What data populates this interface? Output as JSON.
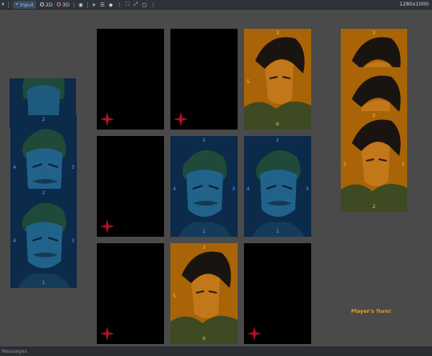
{
  "toolbar": {
    "input_label": "Input",
    "mode_2d": "2D",
    "mode_3d": "3D",
    "resolution": "1280x1000"
  },
  "statusbar": {
    "text": "Messages"
  },
  "game": {
    "turn_text": "Player's Turn!",
    "colors": {
      "blue_card": "#0c2a49",
      "orange_card": "#a86407",
      "back": "#000000",
      "star": "#b0102a",
      "turn_text": "#f0a020"
    }
  },
  "hand_left": [
    {
      "top": "",
      "left": "",
      "right": "",
      "bottom": ""
    },
    {
      "top": "2",
      "left": "4",
      "right": "3",
      "bottom": ""
    },
    {
      "top": "2",
      "left": "4",
      "right": "3",
      "bottom": "1"
    }
  ],
  "board": [
    {
      "type": "back"
    },
    {
      "type": "back"
    },
    {
      "type": "orange",
      "top": "3",
      "left": "5",
      "right": "",
      "bottom": "6"
    },
    {
      "type": "back"
    },
    {
      "type": "blue",
      "top": "2",
      "left": "4",
      "right": "3",
      "bottom": "1"
    },
    {
      "type": "blue",
      "top": "2",
      "left": "4",
      "right": "3",
      "bottom": "1"
    },
    {
      "type": "back"
    },
    {
      "type": "orange",
      "top": "3",
      "left": "5",
      "right": "",
      "bottom": "6"
    },
    {
      "type": "back"
    }
  ],
  "hand_right": [
    {
      "top": "3",
      "left": "",
      "right": "",
      "bottom": "1"
    },
    {
      "top": "",
      "left": "",
      "right": "",
      "bottom": ""
    },
    {
      "top": "2",
      "left": "2",
      "right": "2",
      "bottom": "2"
    }
  ]
}
